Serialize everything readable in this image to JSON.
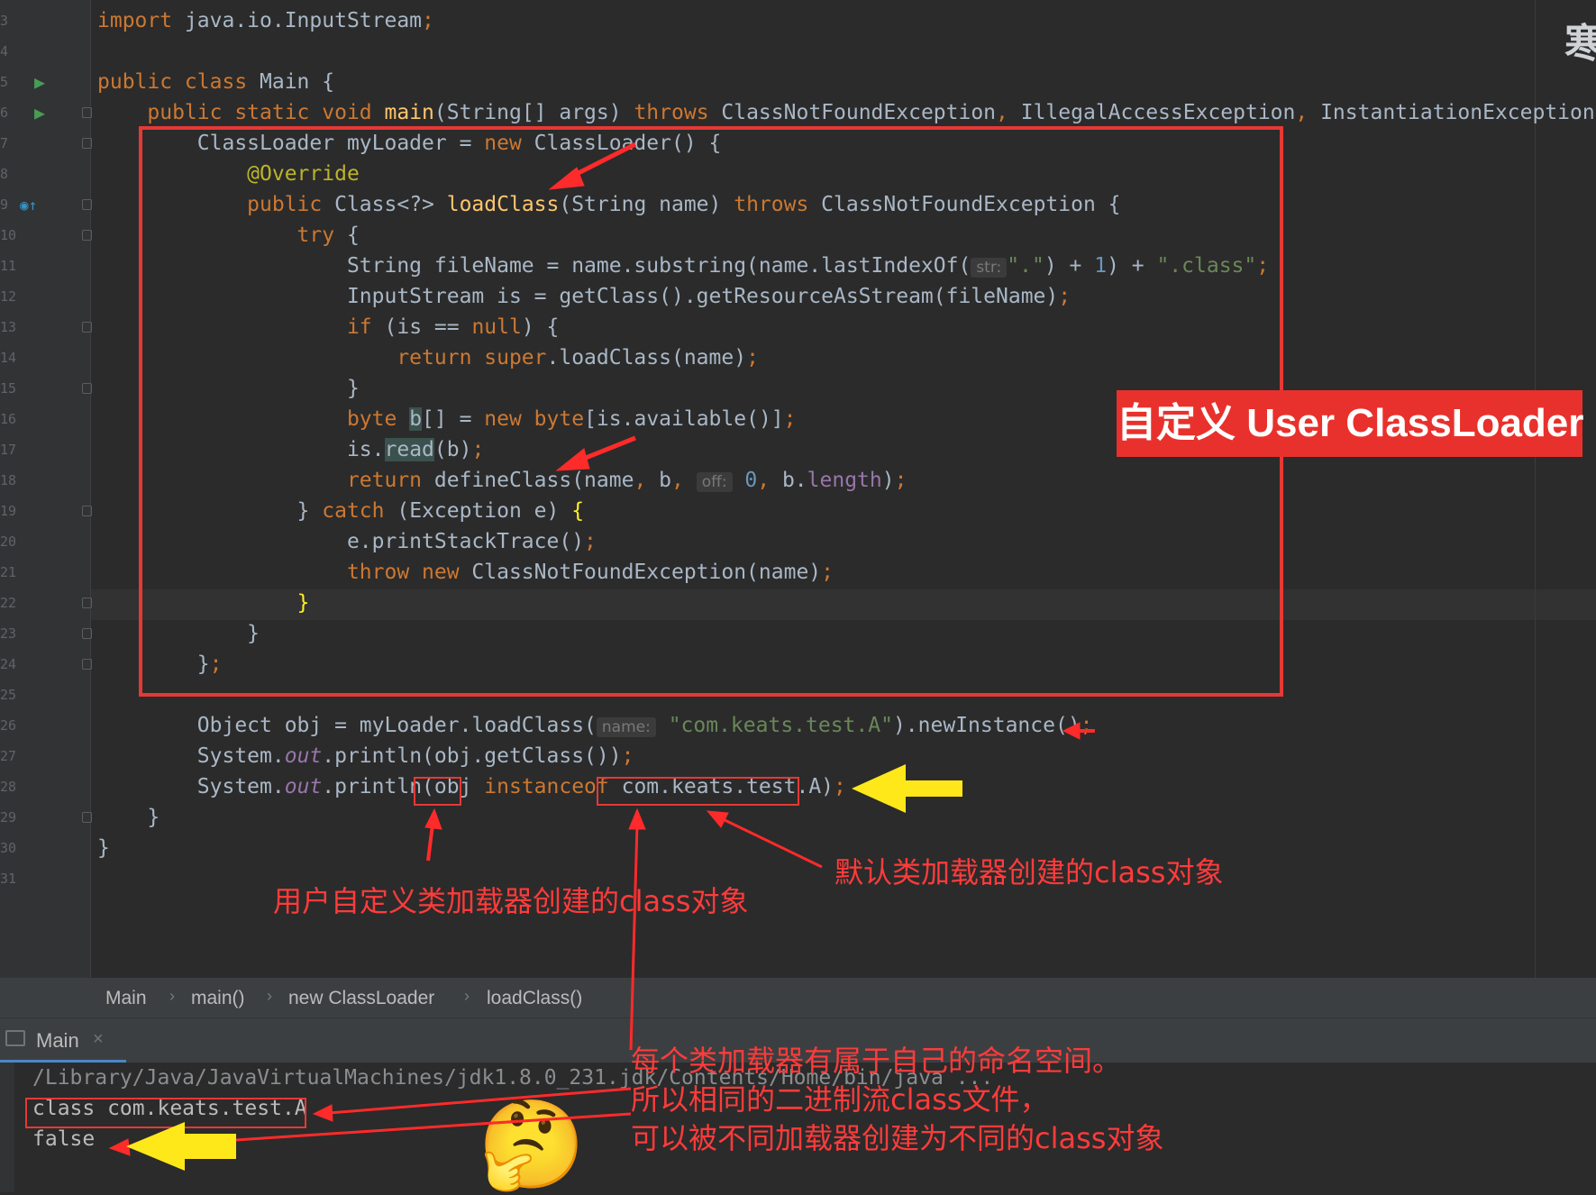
{
  "editor": {
    "code_lines": [
      {
        "n": "3",
        "segments": [
          {
            "t": "import ",
            "c": "kw"
          },
          {
            "t": "java.io.InputStream",
            "c": ""
          },
          {
            "t": ";",
            "c": "kw"
          }
        ]
      },
      {
        "n": "4",
        "segments": []
      },
      {
        "n": "5",
        "segments": [
          {
            "t": "public class ",
            "c": "kw"
          },
          {
            "t": "Main {",
            "c": ""
          }
        ]
      },
      {
        "n": "6",
        "segments": [
          {
            "t": "    public static void ",
            "c": "kw"
          },
          {
            "t": "main",
            "c": "fn"
          },
          {
            "t": "(String[] args) ",
            "c": ""
          },
          {
            "t": "throws ",
            "c": "kw"
          },
          {
            "t": "ClassNotFoundException",
            "c": ""
          },
          {
            "t": ", ",
            "c": "kw"
          },
          {
            "t": "IllegalAccessException",
            "c": ""
          },
          {
            "t": ", ",
            "c": "kw"
          },
          {
            "t": "InstantiationException {",
            "c": ""
          }
        ]
      },
      {
        "n": "7",
        "segments": [
          {
            "t": "        ClassLoader myLoader = ",
            "c": ""
          },
          {
            "t": "new ",
            "c": "kw"
          },
          {
            "t": "ClassLoader() {",
            "c": ""
          }
        ]
      },
      {
        "n": "8",
        "segments": [
          {
            "t": "            ",
            "c": ""
          },
          {
            "t": "@Override",
            "c": "ann"
          }
        ]
      },
      {
        "n": "9",
        "segments": [
          {
            "t": "            public ",
            "c": "kw"
          },
          {
            "t": "Class<?> ",
            "c": ""
          },
          {
            "t": "loadClass",
            "c": "fn"
          },
          {
            "t": "(String name) ",
            "c": ""
          },
          {
            "t": "throws ",
            "c": "kw"
          },
          {
            "t": "ClassNotFoundException {",
            "c": ""
          }
        ]
      },
      {
        "n": "10",
        "segments": [
          {
            "t": "                try ",
            "c": "kw"
          },
          {
            "t": "{",
            "c": ""
          }
        ]
      },
      {
        "n": "11",
        "segments": [
          {
            "t": "                    String fileName = name.substring(name.lastIndexOf(",
            "c": ""
          },
          {
            "t": "str:",
            "c": "hint"
          },
          {
            "t": "\".\"",
            "c": "str"
          },
          {
            "t": ") + ",
            "c": ""
          },
          {
            "t": "1",
            "c": "num"
          },
          {
            "t": ") + ",
            "c": ""
          },
          {
            "t": "\".class\"",
            "c": "str"
          },
          {
            "t": ";",
            "c": "kw"
          }
        ]
      },
      {
        "n": "12",
        "segments": [
          {
            "t": "                    InputStream is = getClass().getResourceAsStream(fileName)",
            "c": ""
          },
          {
            "t": ";",
            "c": "kw"
          }
        ]
      },
      {
        "n": "13",
        "segments": [
          {
            "t": "                    if ",
            "c": "kw"
          },
          {
            "t": "(is == ",
            "c": ""
          },
          {
            "t": "null",
            "c": "kw"
          },
          {
            "t": ") {",
            "c": ""
          }
        ]
      },
      {
        "n": "14",
        "segments": [
          {
            "t": "                        return super",
            "c": "kw"
          },
          {
            "t": ".loadClass(name)",
            "c": ""
          },
          {
            "t": ";",
            "c": "kw"
          }
        ]
      },
      {
        "n": "15",
        "segments": [
          {
            "t": "                    }",
            "c": ""
          }
        ]
      },
      {
        "n": "16",
        "segments": [
          {
            "t": "                    byte ",
            "c": "kw"
          },
          {
            "t": "b",
            "c": "hl"
          },
          {
            "t": "[] = ",
            "c": ""
          },
          {
            "t": "new byte",
            "c": "kw"
          },
          {
            "t": "[is.available()]",
            "c": ""
          },
          {
            "t": ";",
            "c": "kw"
          }
        ]
      },
      {
        "n": "17",
        "segments": [
          {
            "t": "                    is.",
            "c": ""
          },
          {
            "t": "read",
            "c": "hl"
          },
          {
            "t": "(b)",
            "c": ""
          },
          {
            "t": ";",
            "c": "kw"
          }
        ]
      },
      {
        "n": "18",
        "segments": [
          {
            "t": "                    return ",
            "c": "kw"
          },
          {
            "t": "defineClass(name",
            "c": ""
          },
          {
            "t": ", ",
            "c": "kw"
          },
          {
            "t": "b",
            "c": ""
          },
          {
            "t": ", ",
            "c": "kw"
          },
          {
            "t": "off:",
            "c": "hint"
          },
          {
            "t": " 0",
            "c": "num"
          },
          {
            "t": ", ",
            "c": "kw"
          },
          {
            "t": "b.",
            "c": ""
          },
          {
            "t": "length",
            "c": "fld2"
          },
          {
            "t": ")",
            "c": ""
          },
          {
            "t": ";",
            "c": "kw"
          }
        ]
      },
      {
        "n": "19",
        "segments": [
          {
            "t": "                } ",
            "c": ""
          },
          {
            "t": "catch ",
            "c": "kw"
          },
          {
            "t": "(Exception e) ",
            "c": ""
          },
          {
            "t": "{",
            "c": "brace"
          }
        ]
      },
      {
        "n": "20",
        "segments": [
          {
            "t": "                    e.printStackTrace()",
            "c": ""
          },
          {
            "t": ";",
            "c": "kw"
          }
        ]
      },
      {
        "n": "21",
        "segments": [
          {
            "t": "                    throw new ",
            "c": "kw"
          },
          {
            "t": "ClassNotFoundException(name)",
            "c": ""
          },
          {
            "t": ";",
            "c": "kw"
          }
        ]
      },
      {
        "n": "22",
        "segments": [
          {
            "t": "                ",
            "c": ""
          },
          {
            "t": "}",
            "c": "brace"
          }
        ]
      },
      {
        "n": "23",
        "segments": [
          {
            "t": "            }",
            "c": ""
          }
        ]
      },
      {
        "n": "24",
        "segments": [
          {
            "t": "        }",
            "c": ""
          },
          {
            "t": ";",
            "c": "kw"
          }
        ]
      },
      {
        "n": "25",
        "segments": []
      },
      {
        "n": "26",
        "segments": [
          {
            "t": "        Object obj = myLoader.loadClass(",
            "c": ""
          },
          {
            "t": "name:",
            "c": "hint"
          },
          {
            "t": " \"com.keats.test.A\"",
            "c": "str"
          },
          {
            "t": ").newInstance()",
            "c": ""
          },
          {
            "t": ";",
            "c": "kw"
          }
        ]
      },
      {
        "n": "27",
        "segments": [
          {
            "t": "        System.",
            "c": ""
          },
          {
            "t": "out",
            "c": "fld"
          },
          {
            "t": ".println(obj.getClass())",
            "c": ""
          },
          {
            "t": ";",
            "c": "kw"
          }
        ]
      },
      {
        "n": "28",
        "segments": [
          {
            "t": "        System.",
            "c": ""
          },
          {
            "t": "out",
            "c": "fld"
          },
          {
            "t": ".println(obj ",
            "c": ""
          },
          {
            "t": "instanceof ",
            "c": "kw"
          },
          {
            "t": "com.keats.test.A)",
            "c": ""
          },
          {
            "t": ";",
            "c": "kw"
          }
        ]
      },
      {
        "n": "29",
        "segments": [
          {
            "t": "    }",
            "c": ""
          }
        ]
      },
      {
        "n": "30",
        "segments": [
          {
            "t": "}",
            "c": ""
          }
        ]
      },
      {
        "n": "31",
        "segments": []
      }
    ],
    "corner_glyph": "寒"
  },
  "breadcrumb": [
    "Main",
    "main()",
    "new ClassLoader",
    "loadClass()"
  ],
  "run_tab": {
    "label": "Main",
    "close": "×"
  },
  "console": {
    "lines": [
      "/Library/Java/JavaVirtualMachines/jdk1.8.0_231.jdk/Contents/Home/bin/java ...",
      "class com.keats.test.A",
      "false"
    ]
  },
  "annotations": {
    "label": "自定义 User ClassLoader",
    "user_loader_note": "用户自定义类加载器创建的class对象",
    "default_loader_note": "默认类加载器创建的class对象",
    "namespace_notes": [
      "每个类加载器有属于自己的命名空间。",
      "所以相同的二进制流class文件，",
      "可以被不同加载器创建为不同的class对象"
    ],
    "emoji": "🤔"
  },
  "colors": {
    "editor_bg": "#2b2b2b",
    "keyword": "#cc7832",
    "function": "#ffc66d",
    "string": "#6a8759",
    "annotation_red": "#e53935",
    "arrow_yellow": "#ffe81a"
  }
}
